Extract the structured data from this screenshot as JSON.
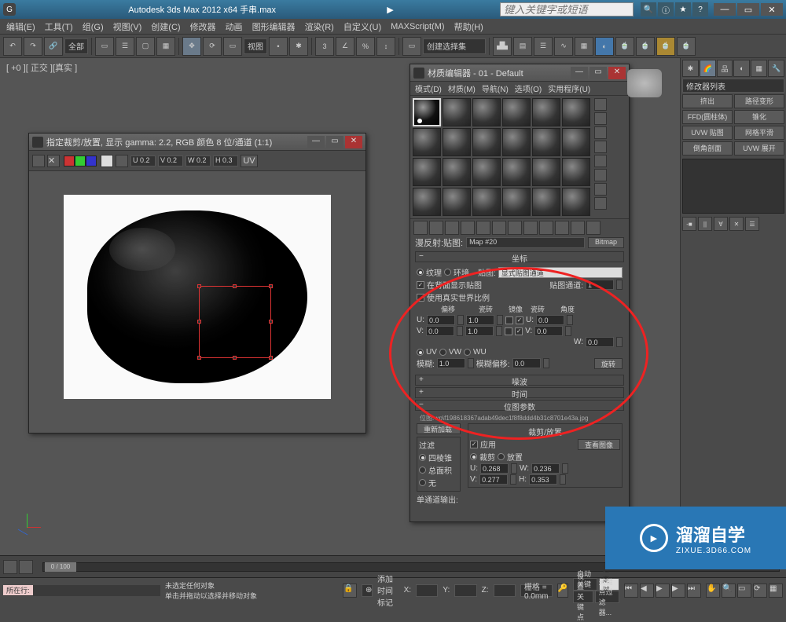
{
  "app": {
    "title": "Autodesk 3ds Max  2012 x64   手串.max",
    "search_placeholder": "键入关键字或短语"
  },
  "menu": [
    "编辑(E)",
    "工具(T)",
    "组(G)",
    "视图(V)",
    "创建(C)",
    "修改器",
    "动画",
    "图形编辑器",
    "渲染(R)",
    "自定义(U)",
    "MAXScript(M)",
    "帮助(H)"
  ],
  "toolbar": {
    "scope": "全部",
    "view": "视图",
    "selset": "创建选择集"
  },
  "viewport": {
    "label": "[ +0 ][ 正交 ][真实 ]"
  },
  "right": {
    "modifier_list": "修改器列表",
    "buttons": [
      "挤出",
      "路径变形",
      "FFD(圆柱体)",
      "锥化",
      "UVW 贴图",
      "网格平滑",
      "倒角剖面",
      "UVW 展开"
    ],
    "pin": "-■"
  },
  "render_window": {
    "title": "指定裁剪/放置, 显示 gamma: 2.2, RGB 颜色 8 位/通道 (1:1)",
    "channels": [
      "U 0.2",
      "V 0.2",
      "W 0.2",
      "H 0.3"
    ],
    "uv_btn": "UV"
  },
  "material_editor": {
    "title": "材质编辑器 - 01 - Default",
    "menu": [
      "模式(D)",
      "材质(M)",
      "导航(N)",
      "选项(O)",
      "实用程序(U)"
    ],
    "diffuse_label": "漫反射:贴图:",
    "map_name": "Map #20",
    "map_type": "Bitmap",
    "coords": {
      "head": "坐标",
      "tex_radio": "纹理",
      "env_radio": "环境",
      "map_label": "贴图:",
      "map_drop": "显式贴图通道",
      "show_back": "在背面显示贴图",
      "map_ch_label": "贴图通道:",
      "map_ch_val": "1",
      "use_real": "使用真实世界比例",
      "cols": [
        "偏移",
        "瓷砖",
        "镜像",
        "瓷砖",
        "角度"
      ],
      "u_label": "U:",
      "v_label": "V:",
      "w_label": "W:",
      "u_off": "0.0",
      "u_tile": "1.0",
      "u_ang": "0.0",
      "v_off": "0.0",
      "v_tile": "1.0",
      "v_ang": "0.0",
      "w_ang": "0.0",
      "uv": "UV",
      "vw": "VW",
      "wu": "WU",
      "blur_label": "模糊:",
      "blur": "1.0",
      "bluroff_label": "模糊偏移:",
      "bluroff": "0.0",
      "rotate": "旋转"
    },
    "noise_head": "噪波",
    "time_head": "时间",
    "bmpparam_head": "位图参数",
    "bitmap_path": "位图: xp\\f198618367adab49dec1f8f8ddd4b31c8701e43a.jpg",
    "reload": "重新加载",
    "crop_head": "裁剪/放置",
    "apply": "应用",
    "view_image": "查看图像",
    "crop_radio": "裁剪",
    "place_radio": "放置",
    "crop_u": "0.268",
    "crop_w": "0.236",
    "crop_v": "0.277",
    "crop_h": "0.353",
    "filter_head": "过滤",
    "filter_pyramid": "四棱锥",
    "filter_sum": "总面积",
    "filter_none": "无",
    "mono_out": "单通道输出:"
  },
  "status": {
    "none_selected": "未选定任何对象",
    "hint": "单击并拖动以选择并移动对象",
    "current": "所在行:",
    "add_time": "添加时间标记",
    "x": "X:",
    "y": "Y:",
    "z": "Z:",
    "grid": "栅格 = 0.0mm",
    "autokey": "自动关键点",
    "setkey": "设置关键点",
    "selset": "选定对象",
    "keyfilter": "关键点过滤器...",
    "frame": "0 / 100"
  },
  "watermark": {
    "big": "溜溜自学",
    "small": "ZIXUE.3D66.COM"
  }
}
